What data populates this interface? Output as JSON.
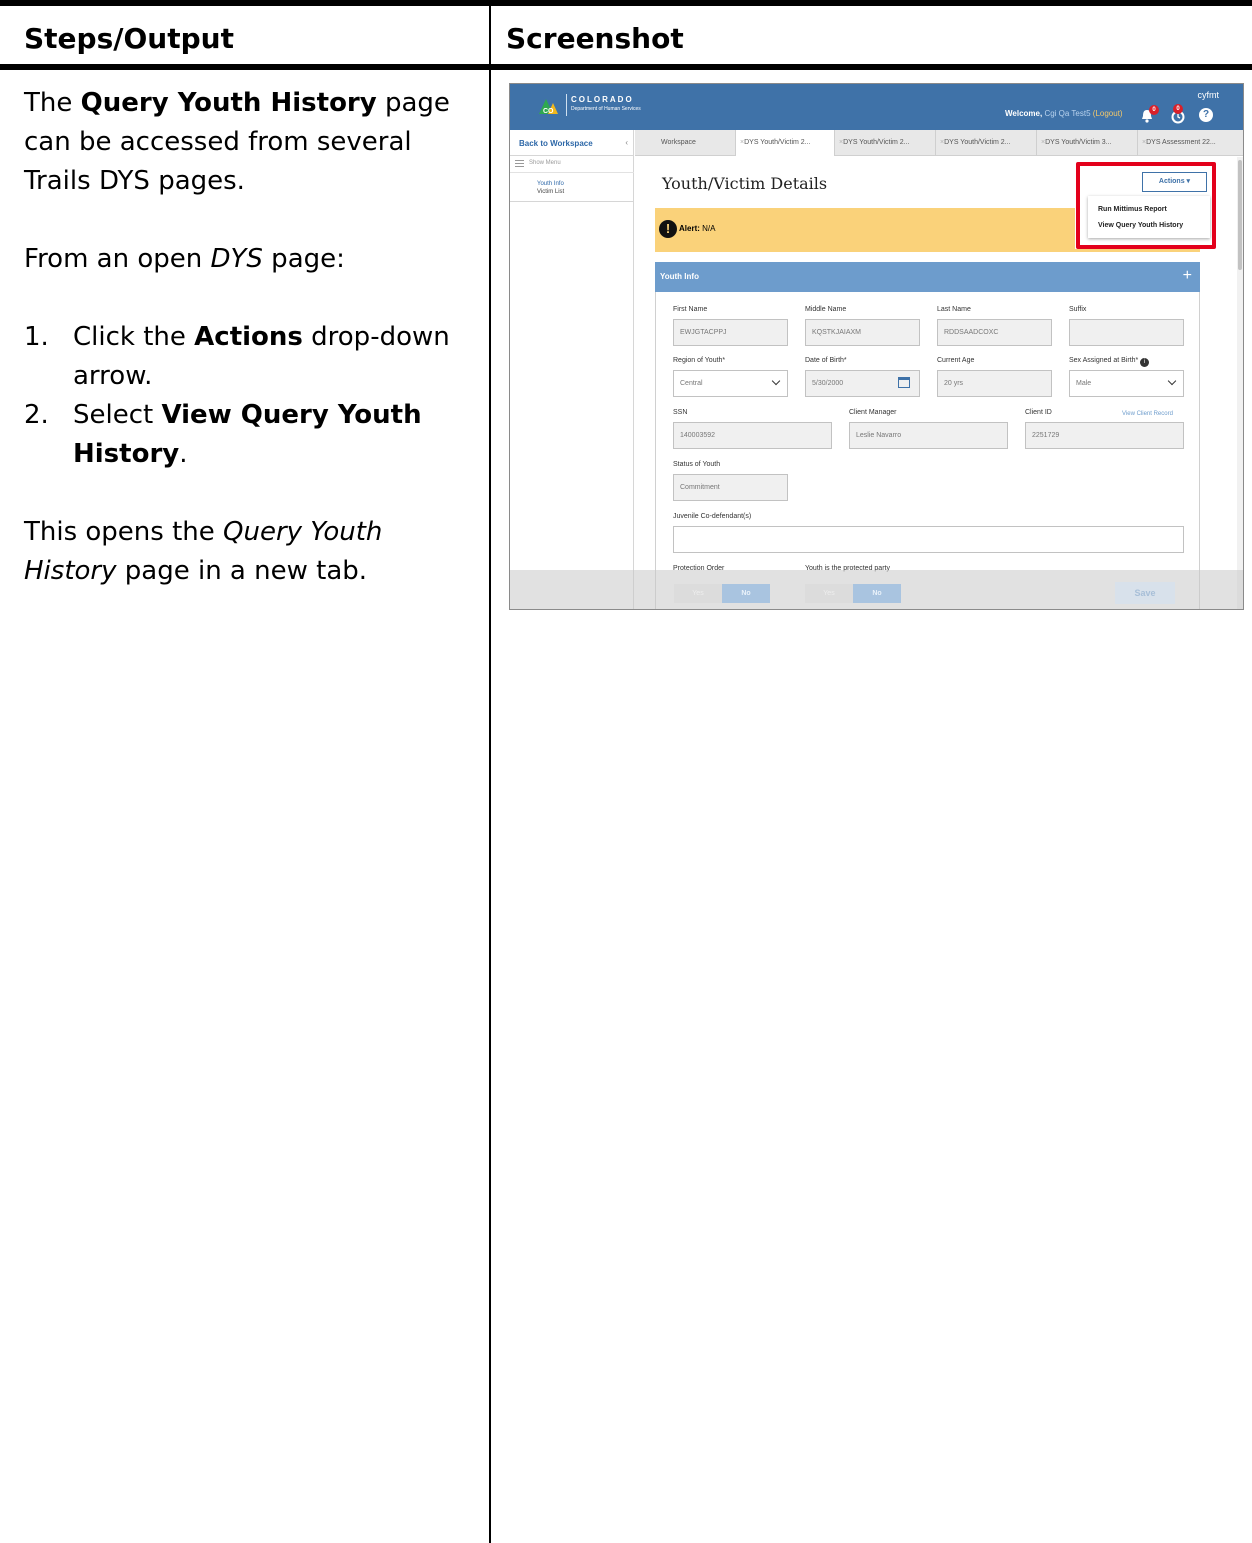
{
  "document": {
    "header_left": "Steps/Output",
    "header_right": "Screenshot",
    "intro": {
      "pre": "The ",
      "bold": "Query Youth History",
      "post": " page can be accessed from several Trails DYS pages."
    },
    "from": {
      "pre": "From an open ",
      "italic": "DYS",
      "post": " page:"
    },
    "steps": [
      {
        "num": "1.",
        "pre": "Click the ",
        "bold": "Actions",
        "post": " drop-down arrow."
      },
      {
        "num": "2.",
        "pre": "Select ",
        "bold": "View Query Youth History",
        "post": "."
      }
    ],
    "outro": {
      "pre": "This opens the ",
      "italic": "Query Youth History",
      "post": " page in a new tab."
    }
  },
  "app": {
    "logo_title": "COLORADO",
    "logo_sub": "Department of Human Services",
    "logo_badge": "CDHS",
    "user_code": "cyfmt",
    "welcome_label": "Welcome,",
    "user_name": "Cgi Qa Test5",
    "logout_label": "(Logout)",
    "notif_count": "0",
    "history_count": "0",
    "help_glyph": "?",
    "back_label": "Back to Workspace",
    "back_chevron": "‹",
    "show_menu": "Show Menu",
    "nav_items": [
      "Youth Info",
      "Victim List"
    ],
    "tabs": [
      "Workspace",
      "DYS Youth/Victim 2...",
      "DYS Youth/Victim 2...",
      "DYS Youth/Victim 2...",
      "DYS Youth/Victim 3...",
      "DYS Assessment 22..."
    ],
    "tab_close": "×",
    "page_title": "Youth/Victim Details",
    "actions_label": "Actions ▾",
    "actions_menu": [
      "Run Mittimus Report",
      "View Query Youth History"
    ],
    "alert_icon": "!",
    "alert_label": "Alert:",
    "alert_value": "N/A",
    "section_title": "Youth Info",
    "section_toggle": "+",
    "fields": {
      "first_name": {
        "label": "First Name",
        "value": "EWJGTACPPJ"
      },
      "middle_name": {
        "label": "Middle Name",
        "value": "KQSTKJAIAXM"
      },
      "last_name": {
        "label": "Last Name",
        "value": "RDDSAADCOXC"
      },
      "suffix": {
        "label": "Suffix",
        "value": ""
      },
      "region": {
        "label": "Region of Youth*",
        "value": "Central"
      },
      "dob": {
        "label": "Date of Birth*",
        "value": "5/30/2000"
      },
      "age": {
        "label": "Current Age",
        "value": "20 yrs"
      },
      "sex": {
        "label": "Sex Assigned at Birth*",
        "value": "Male"
      },
      "ssn": {
        "label": "SSN",
        "value": "140003592"
      },
      "client_manager": {
        "label": "Client Manager",
        "value": "Leslie Navarro"
      },
      "client_id": {
        "label": "Client ID",
        "value": "2251729"
      },
      "status": {
        "label": "Status of Youth",
        "value": "Commitment"
      },
      "codefendant": {
        "label": "Juvenile Co-defendant(s)",
        "value": ""
      },
      "protection_order": {
        "label": "Protection Order"
      },
      "protected_party": {
        "label": "Youth is the protected party"
      }
    },
    "view_client_record": "View Client Record",
    "info_glyph": "i",
    "toggle_yes": "Yes",
    "toggle_no": "No",
    "save_label": "Save"
  }
}
